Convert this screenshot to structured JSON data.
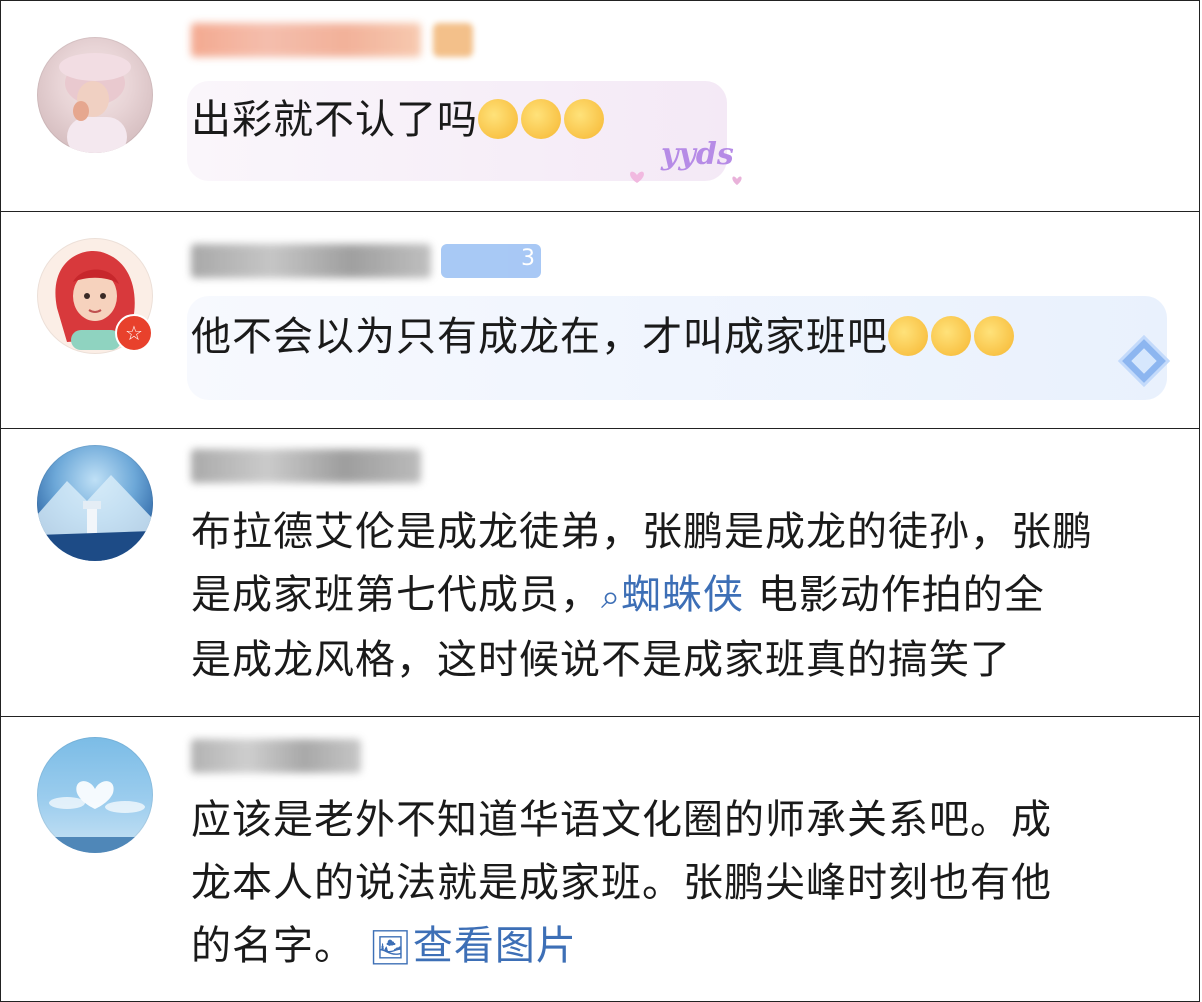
{
  "comments": [
    {
      "author_blurred": true,
      "text": "出彩就不认了吗",
      "emoji_count": 3,
      "decoration_text": "yyds"
    },
    {
      "author_blurred": true,
      "text": "他不会以为只有成龙在，才叫成家班吧",
      "emoji_count": 3,
      "badge_text": "3"
    },
    {
      "author_blurred": true,
      "line1": "布拉德艾伦是成龙徒弟，张鹏是成龙的徒孙，张鹏",
      "line2_before": "是成家班第七代成员，",
      "search_link": "蜘蛛侠",
      "line2_after": "电影动作拍的全",
      "line3": "是成龙风格，这时候说不是成家班真的搞笑了"
    },
    {
      "author_blurred": true,
      "line1": "应该是老外不知道华语文化圈的师承关系吧。成",
      "line2": "龙本人的说法就是成家班。张鹏尖峰时刻也有他",
      "line3_before": "的名字。",
      "view_image_link": "查看图片"
    }
  ],
  "colors": {
    "link": "#3d6fb6",
    "bubble_pink": "#f6eef8",
    "bubble_blue": "#edf3fd"
  }
}
